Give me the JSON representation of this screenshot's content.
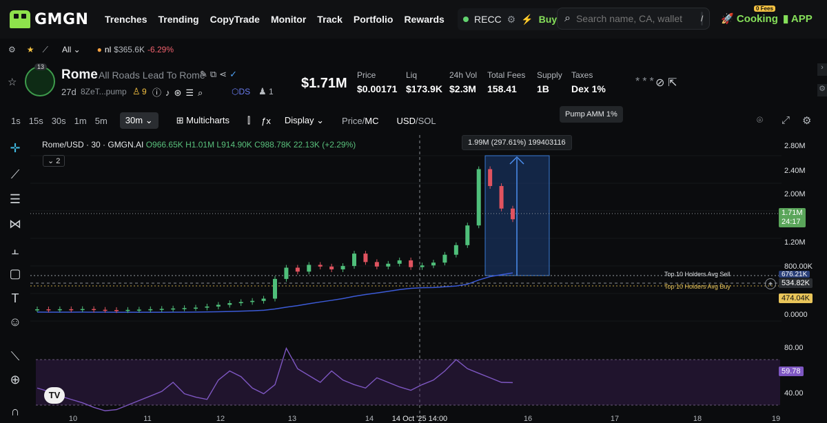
{
  "brand": {
    "name": "GMGN"
  },
  "nav": [
    "Trenches",
    "Trending",
    "CopyTrade",
    "Monitor",
    "Track",
    "Portfolio",
    "Rewards"
  ],
  "topbar": {
    "recc": "RECC",
    "buy": "Buy",
    "search_placeholder": "Search name, CA, wallet",
    "search_kbd": "/",
    "cooking": "Cooking",
    "fees_badge": "0 Fees",
    "app": "APP"
  },
  "subbar": {
    "filter": "All",
    "ticker": "nl",
    "mcap": "$365.6K",
    "change": "-6.29%"
  },
  "token": {
    "avatar_badge": "13",
    "name": "Rome",
    "subtitle": "All Roads Lead To Rome",
    "age": "27d",
    "ca": "8ZeT...pump",
    "holders_count": "9",
    "ds": "DS",
    "ds_count": "1",
    "mcap": "$1.71M"
  },
  "stats": [
    {
      "label": "Price",
      "value": "$0.00171"
    },
    {
      "label": "Liq",
      "value": "$173.9K"
    },
    {
      "label": "24h Vol",
      "value": "$2.3M"
    },
    {
      "label": "Total Fees",
      "value": "158.41"
    },
    {
      "label": "Supply",
      "value": "1B"
    },
    {
      "label": "Taxes",
      "value": "Dex 1%"
    }
  ],
  "tooltip": "Pump AMM 1%",
  "chart_toolbar": {
    "timeframes": [
      "1s",
      "15s",
      "30s",
      "1m",
      "5m"
    ],
    "active_timeframe": "30m",
    "multicharts": "Multicharts",
    "display": "Display",
    "price": "Price",
    "mc": "MC",
    "usd": "USD",
    "sol": "SOL"
  },
  "legend": {
    "symbol": "Rome/USD · 30 · GMGN.AI",
    "ohlc": "O966.65K  H1.01M  L914.90K  C988.78K  22.13K (+2.29%)",
    "badge": "2"
  },
  "measure": "1.99M (297.61%) 199403116",
  "holders": {
    "sell": "Top 10 Holders Avg Sell",
    "buy": "Top 10 Holders Avg Buy"
  },
  "chart_data": {
    "type": "line",
    "x_labels": [
      "10",
      "11",
      "12",
      "13",
      "14",
      "14 Oct '25 14:00",
      "16",
      "17",
      "18",
      "19"
    ],
    "y_ticks": [
      "2.80M",
      "2.40M",
      "2.00M",
      "1.20M",
      "800.00K",
      "0.0000"
    ],
    "price_tags": {
      "current": "1.71M",
      "countdown": "24:17",
      "sell": "676.21K",
      "crosshair": "534.82K",
      "buy": "474.04K"
    },
    "rsi_ticks": [
      "80.00",
      "40.00"
    ],
    "rsi_value": "59.78",
    "ylim": [
      0,
      2900000
    ],
    "close": [
      110000,
      105000,
      112000,
      108000,
      115000,
      102000,
      98000,
      95000,
      100000,
      105000,
      112000,
      118000,
      125000,
      132000,
      140000,
      160000,
      190000,
      220000,
      240000,
      260000,
      300000,
      650000,
      850000,
      780000,
      900000,
      870000,
      820000,
      880000,
      1100000,
      950000,
      870000,
      920000,
      980000,
      860000,
      890000,
      940000,
      1080000,
      1250000,
      1600000,
      2600000,
      2300000,
      1900000,
      1710000
    ],
    "rsi": [
      55,
      52,
      48,
      45,
      42,
      38,
      35,
      36,
      40,
      44,
      48,
      52,
      60,
      50,
      47,
      45,
      62,
      70,
      65,
      55,
      50,
      58,
      90,
      72,
      66,
      60,
      70,
      62,
      58,
      55,
      64,
      60,
      56,
      53,
      58,
      62,
      70,
      80,
      72,
      68,
      64,
      60,
      59.78
    ]
  }
}
